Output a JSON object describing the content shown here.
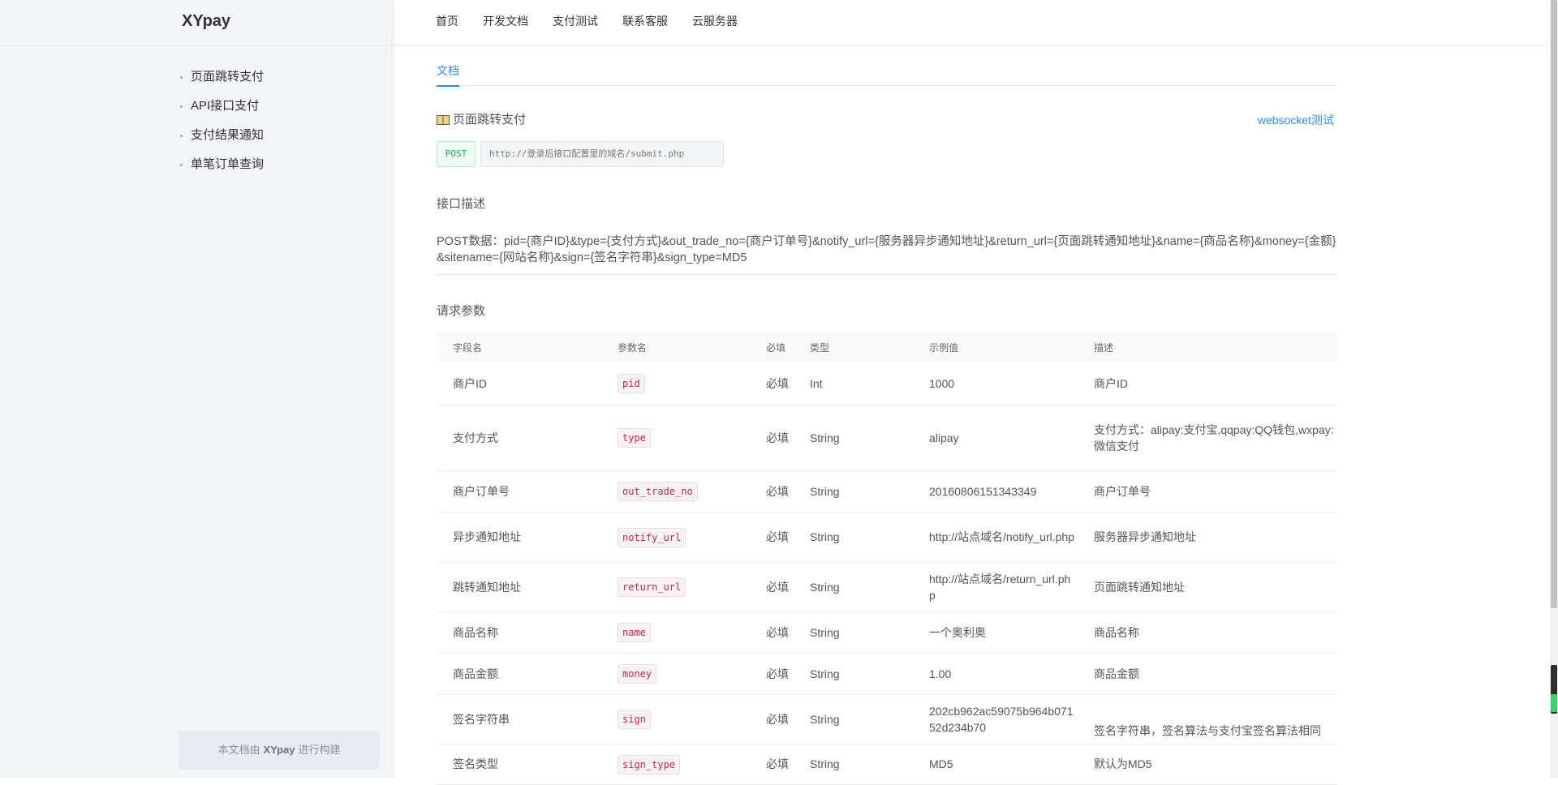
{
  "brand": "XYpay",
  "sidebar": {
    "items": [
      {
        "label": "页面跳转支付"
      },
      {
        "label": "API接口支付"
      },
      {
        "label": "支付结果通知"
      },
      {
        "label": "单笔订单查询"
      }
    ],
    "built_by_prefix": "本文档由",
    "built_by_brand": "XYpay",
    "built_by_suffix": "进行构建"
  },
  "topnav": [
    {
      "label": "首页"
    },
    {
      "label": "开发文档"
    },
    {
      "label": "支付测试"
    },
    {
      "label": "联系客服"
    },
    {
      "label": "云服务器"
    }
  ],
  "tabs": {
    "active": "文档"
  },
  "section": {
    "title": "页面跳转支付",
    "ws_link": "websocket测试",
    "method": "POST",
    "url": "http://登录后接口配置里的域名/submit.php",
    "desc_title": "接口描述",
    "desc_body": "POST数据：pid={商户ID}&type={支付方式}&out_trade_no={商户订单号}&notify_url={服务器异步通知地址}&return_url={页面跳转通知地址}&name={商品名称}&money={金额}&sitename={网站名称}&sign={签名字符串}&sign_type=MD5",
    "params_title": "请求参数"
  },
  "table": {
    "headers": [
      "字段名",
      "参数名",
      "必填",
      "类型",
      "示例值",
      "描述"
    ],
    "rows": [
      {
        "field": "商户ID",
        "param": "pid",
        "required": "必填",
        "type": "Int",
        "example": "1000",
        "desc": "商户ID"
      },
      {
        "field": "支付方式",
        "param": "type",
        "required": "必填",
        "type": "String",
        "example": "alipay",
        "desc": "支付方式：alipay:支付宝,qqpay:QQ钱包,wxpay:微信支付"
      },
      {
        "field": "商户订单号",
        "param": "out_trade_no",
        "required": "必填",
        "type": "String",
        "example": "20160806151343349",
        "desc": "商户订单号"
      },
      {
        "field": "异步通知地址",
        "param": "notify_url",
        "required": "必填",
        "type": "String",
        "example": "http://站点域名/notify_url.php",
        "desc": "服务器异步通知地址"
      },
      {
        "field": "跳转通知地址",
        "param": "return_url",
        "required": "必填",
        "type": "String",
        "example": "http://站点域名/return_url.php",
        "desc": "页面跳转通知地址"
      },
      {
        "field": "商品名称",
        "param": "name",
        "required": "必填",
        "type": "String",
        "example": "一个奥利奥",
        "desc": "商品名称"
      },
      {
        "field": "商品金额",
        "param": "money",
        "required": "必填",
        "type": "String",
        "example": "1.00",
        "desc": "商品金额"
      },
      {
        "field": "签名字符串",
        "param": "sign",
        "required": "必填",
        "type": "String",
        "example": "202cb962ac59075b964b07152d234b70",
        "desc": "签名字符串，签名算法与支付宝签名算法相同"
      },
      {
        "field": "签名类型",
        "param": "sign_type",
        "required": "必填",
        "type": "String",
        "example": "MD5",
        "desc": "默认为MD5"
      }
    ]
  }
}
